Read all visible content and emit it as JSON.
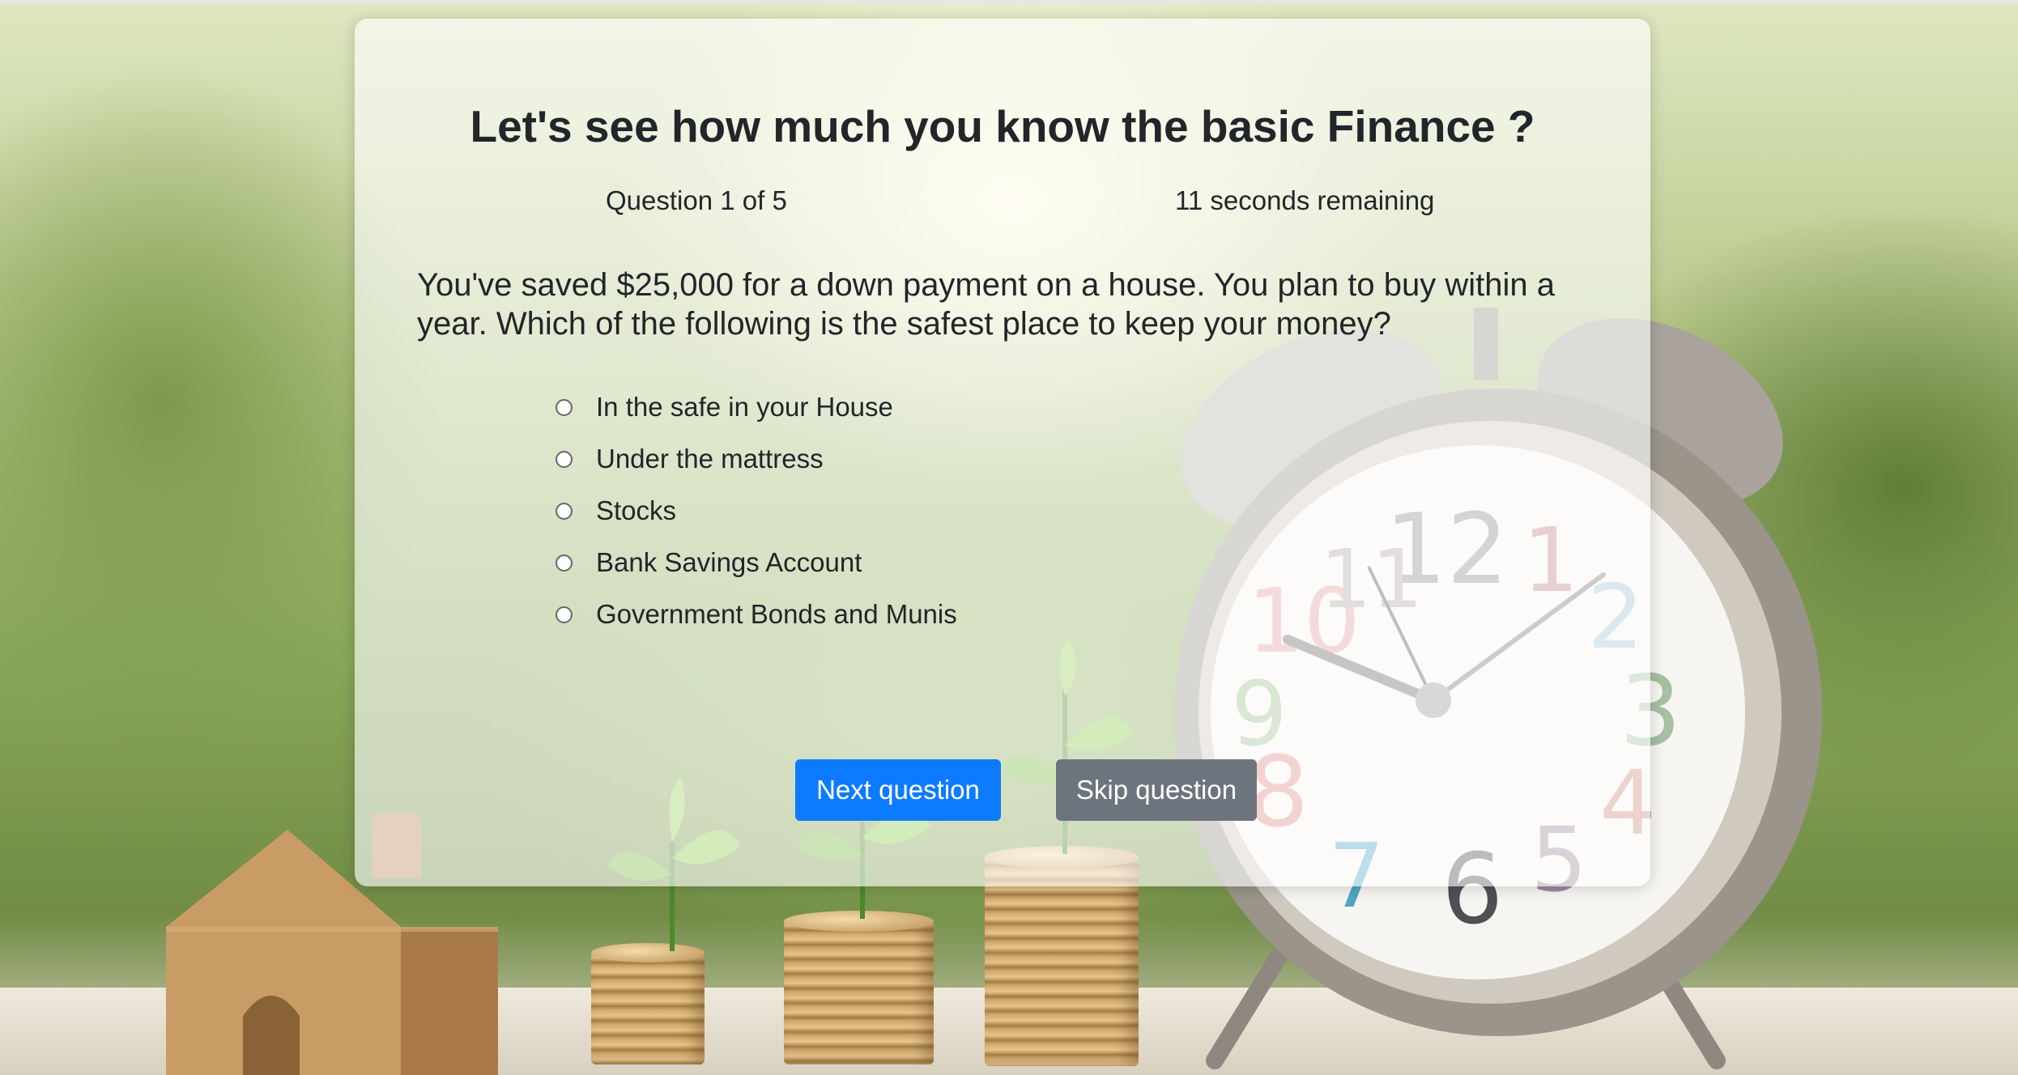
{
  "quiz": {
    "title": "Let's see how much you know the basic Finance ?",
    "counter": "Question 1 of 5",
    "timer": "11 seconds remaining",
    "question": "You've saved $25,000 for a down payment on a house. You plan to buy within a year. Which of the following is the safest place to keep your money?",
    "options": [
      {
        "label": "In the safe in your House",
        "selected": false
      },
      {
        "label": "Under the mattress",
        "selected": false
      },
      {
        "label": "Stocks",
        "selected": false
      },
      {
        "label": "Bank Savings Account",
        "selected": false
      },
      {
        "label": "Government Bonds and Munis",
        "selected": false
      }
    ],
    "buttons": {
      "next": "Next question",
      "skip": "Skip question"
    }
  },
  "colors": {
    "primary": "#0d7bff",
    "secondary": "#6c757d",
    "text": "#222529"
  },
  "background": {
    "scene": "house, coin stacks with sprouts, alarm clock",
    "clock_face_numbers": [
      "12",
      "1",
      "2",
      "3",
      "4",
      "5",
      "6",
      "7",
      "8",
      "9",
      "10",
      "11"
    ]
  }
}
